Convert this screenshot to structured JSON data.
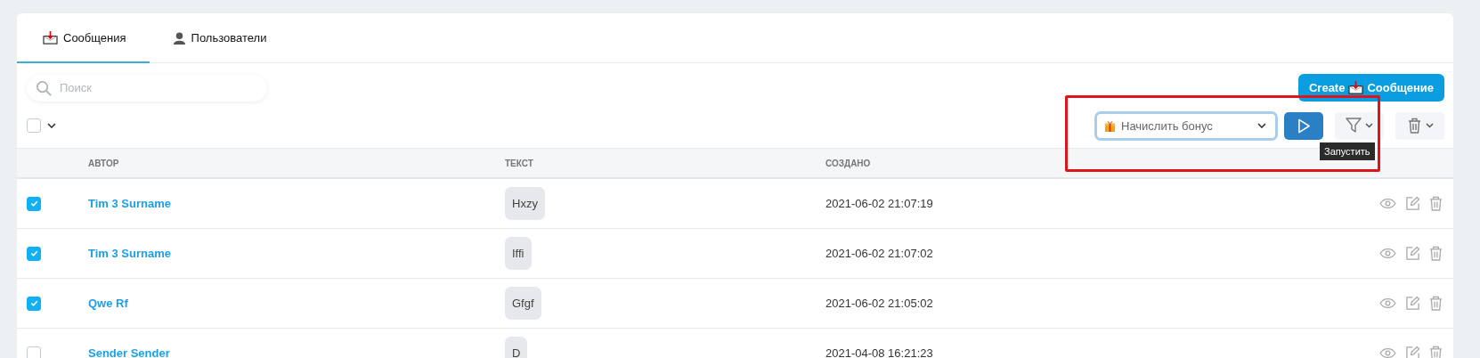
{
  "tabs": [
    {
      "label": "Сообщения",
      "selected": true,
      "kind": "messages"
    },
    {
      "label": "Пользователи",
      "selected": false,
      "kind": "users"
    }
  ],
  "search": {
    "placeholder": "Поиск"
  },
  "create_button": {
    "label_before": "Create",
    "label_after": "Сообщение"
  },
  "select_all": {
    "checked": false
  },
  "bulk_action": {
    "value": "Начислить бонус"
  },
  "run_tooltip": "Запустить",
  "highlight_frame": true,
  "table": {
    "columns": [
      "АВТОР",
      "ТЕКСТ",
      "СОЗДАНО"
    ],
    "rows": [
      {
        "selected": true,
        "author": "Tim 3 Surname",
        "text": "Hxzy",
        "created": "2021-06-02 21:07:19"
      },
      {
        "selected": true,
        "author": "Tim 3 Surname",
        "text": "Iffi",
        "created": "2021-06-02 21:07:02"
      },
      {
        "selected": true,
        "author": "Qwe Rf",
        "text": "Gfgf",
        "created": "2021-06-02 21:05:02"
      },
      {
        "selected": false,
        "author": "Sender Sender",
        "text": "D",
        "created": "2021-04-08 16:21:23"
      }
    ]
  }
}
